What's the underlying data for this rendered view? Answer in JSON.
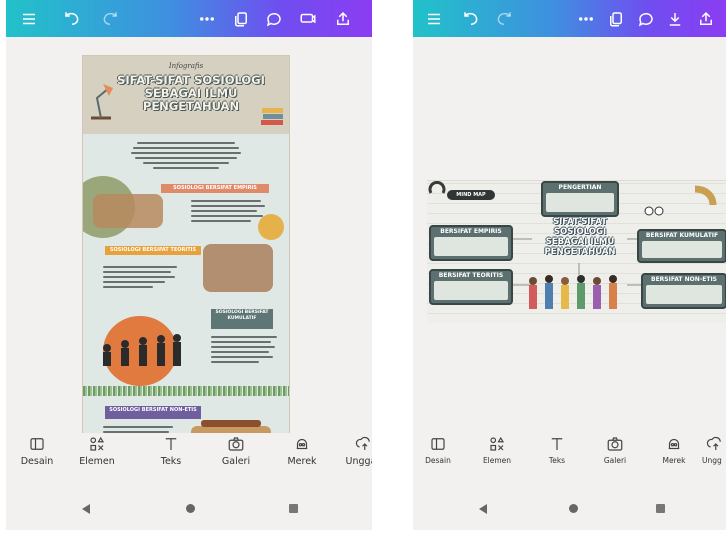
{
  "left_screen": {
    "infographic": {
      "subtitle": "Infografis",
      "title": "SIFAT-SIFAT SOSIOLOGI SEBAGAI ILMU PENGETAHUAN",
      "sections": [
        "SOSIOLOGI BERSIFAT EMPIRIS",
        "SOSIOLOGI BERSIFAT TEORITIS",
        "SOSIOLOGI BERSIFAT KUMULATIF",
        "SOSIOLOGI BERSIFAT NON-ETIS"
      ]
    },
    "tools": [
      {
        "label": "Desain",
        "icon": "layout-icon"
      },
      {
        "label": "Elemen",
        "icon": "shapes-icon"
      },
      {
        "label": "Teks",
        "icon": "text-icon"
      },
      {
        "label": "Galeri",
        "icon": "camera-icon"
      },
      {
        "label": "Merek",
        "icon": "brand-icon"
      },
      {
        "label": "Unggah",
        "icon": "upload-icon"
      }
    ]
  },
  "right_screen": {
    "mindmap": {
      "tag": "MIND MAP",
      "center_title": "SIFAT-SIFAT SOSIOLOGI SEBAGAI ILMU PENGETAHUAN",
      "boxes": {
        "pengertian": "PENGERTIAN",
        "empiris": "BERSIFAT EMPIRIS",
        "kumulatif": "BERSIFAT KUMULATIF",
        "teoritis": "BERSIFAT TEORITIS",
        "non_etis": "BERSIFAT NON-ETIS"
      }
    },
    "tools": [
      {
        "label": "Desain",
        "icon": "layout-icon"
      },
      {
        "label": "Elemen",
        "icon": "shapes-icon"
      },
      {
        "label": "Teks",
        "icon": "text-icon"
      },
      {
        "label": "Galeri",
        "icon": "camera-icon"
      },
      {
        "label": "Merek",
        "icon": "brand-icon"
      },
      {
        "label": "Ungg",
        "icon": "upload-icon"
      }
    ]
  },
  "colors": {
    "topbar_start": "#21c2c9",
    "topbar_end": "#8b3df3",
    "infographic_bg": "#dfe8e4",
    "mindmap_box": "#5d7070"
  }
}
